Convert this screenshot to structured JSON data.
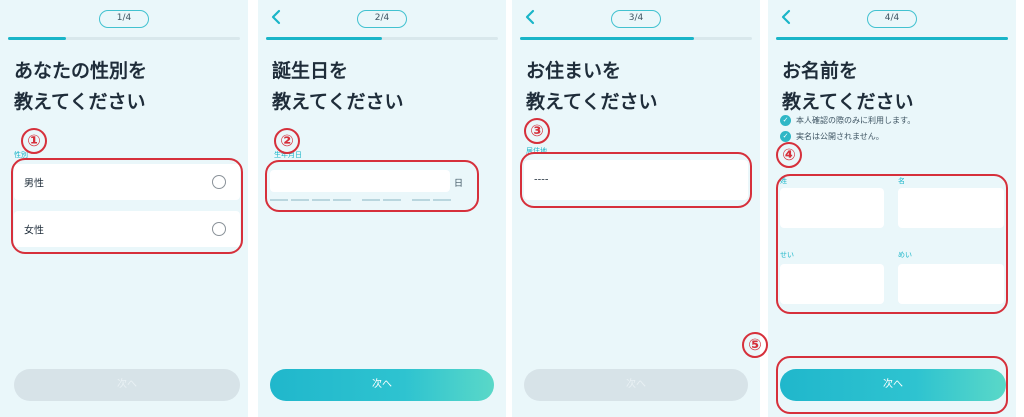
{
  "accent_color": "#1ab5c8",
  "annotation_color": "#d6303b",
  "panels": [
    {
      "step": "1/4",
      "progress": 0.25,
      "has_back": false,
      "heading": [
        "あなたの性別を",
        "教えてください"
      ],
      "field_label": "性別",
      "options": [
        "男性",
        "女性"
      ],
      "next_label": "次へ",
      "next_enabled": false,
      "annotation": "①"
    },
    {
      "step": "2/4",
      "progress": 0.5,
      "has_back": true,
      "heading": [
        "誕生日を",
        "教えてください"
      ],
      "field_label": "生年月日",
      "day_unit": "日",
      "next_label": "次へ",
      "next_enabled": true,
      "annotation": "②"
    },
    {
      "step": "3/4",
      "progress": 0.75,
      "has_back": true,
      "heading": [
        "お住まいを",
        "教えてください"
      ],
      "field_label": "居住地",
      "select_value": "----",
      "next_label": "次へ",
      "next_enabled": false,
      "annotation": "③"
    },
    {
      "step": "4/4",
      "progress": 1.0,
      "has_back": true,
      "heading": [
        "お名前を",
        "教えてください"
      ],
      "notes": [
        "本人確認の際のみに利用します。",
        "実名は公開されません。"
      ],
      "fields": {
        "last_name": "姓",
        "first_name": "名",
        "last_name_kana": "せい",
        "first_name_kana": "めい"
      },
      "next_label": "次へ",
      "next_enabled": true,
      "annotation": "④",
      "button_annotation": "⑤"
    }
  ]
}
